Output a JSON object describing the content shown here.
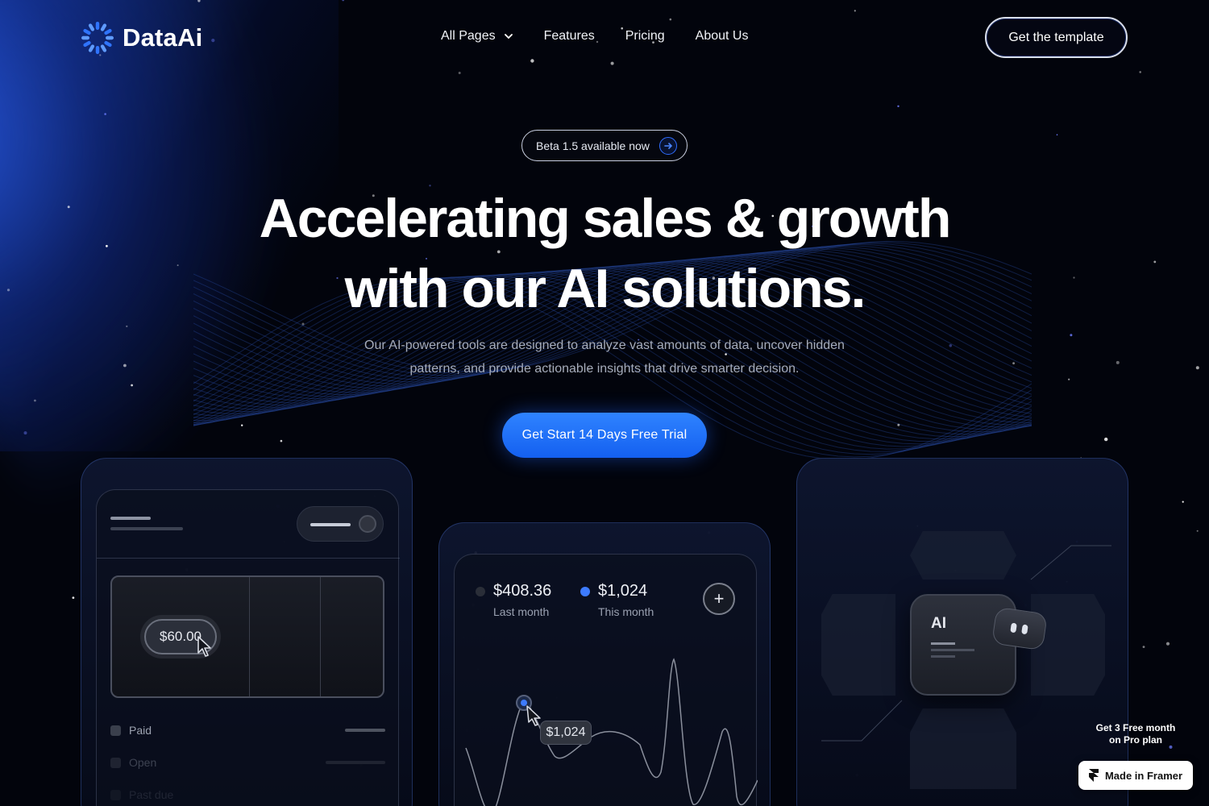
{
  "brand": {
    "name": "DataAi",
    "accent": "#1f6fff"
  },
  "nav": {
    "items": [
      {
        "label": "All Pages",
        "has_dropdown": true
      },
      {
        "label": "Features"
      },
      {
        "label": "Pricing"
      },
      {
        "label": "About Us"
      }
    ],
    "cta": "Get the template"
  },
  "hero": {
    "badge": "Beta 1.5 available now",
    "headline_line1": "Accelerating sales & growth",
    "headline_line2": "with our AI solutions.",
    "subtitle_line1": "Our AI-powered tools are designed to analyze vast amounts of data, uncover hidden",
    "subtitle_line2": "patterns, and provide actionable insights that drive smarter decision.",
    "cta": "Get Start 14 Days Free Trial"
  },
  "cards": {
    "payment": {
      "price": "$60.00",
      "rows": [
        "Paid",
        "Open",
        "Past due"
      ]
    },
    "stats": {
      "last_month_value": "$408.36",
      "last_month_label": "Last month",
      "this_month_value": "$1,024",
      "this_month_label": "This month",
      "plus": "+",
      "tooltip": "$1,024"
    },
    "ai": {
      "label": "AI"
    }
  },
  "promo": {
    "line1": "Get 3 Free month",
    "line2": "on Pro plan"
  },
  "framer_badge": "Made in Framer"
}
